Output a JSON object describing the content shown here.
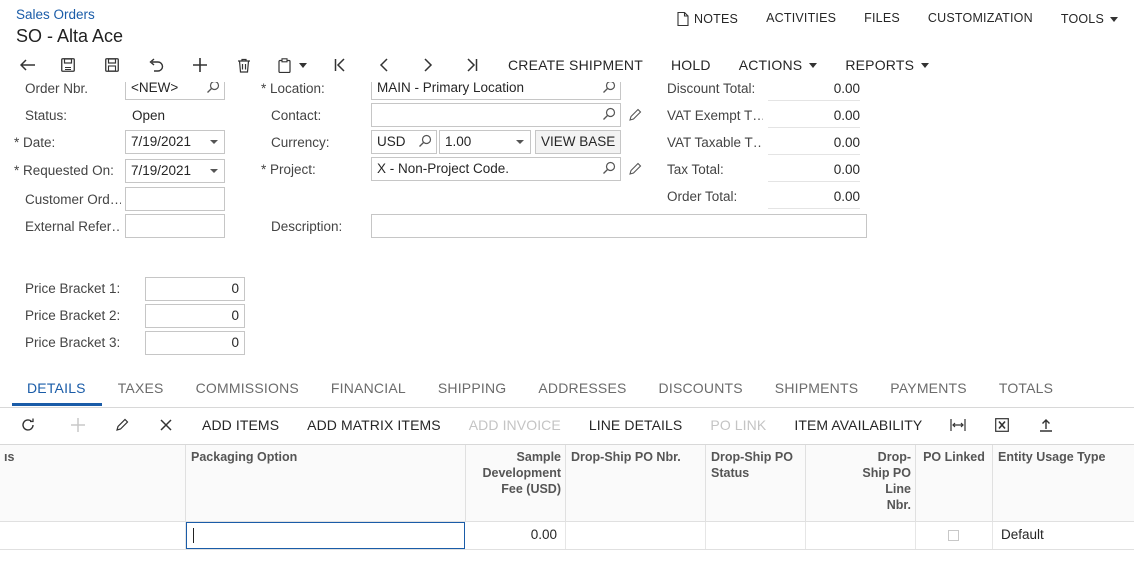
{
  "header": {
    "breadcrumb": "Sales Orders",
    "title": "SO - Alta Ace",
    "links": {
      "notes": "NOTES",
      "activities": "ACTIVITIES",
      "files": "FILES",
      "customization": "CUSTOMIZATION",
      "tools": "TOOLS"
    }
  },
  "toolbar": {
    "create_shipment": "CREATE SHIPMENT",
    "hold": "HOLD",
    "actions": "ACTIONS",
    "reports": "REPORTS"
  },
  "form": {
    "order_nbr": {
      "label": "Order Nbr.",
      "value": "<NEW>"
    },
    "status": {
      "label": "Status:",
      "value": "Open"
    },
    "date": {
      "label": "Date:",
      "value": "7/19/2021"
    },
    "requested_on": {
      "label": "Requested On:",
      "value": "7/19/2021"
    },
    "customer_order": {
      "label": "Customer Ord…",
      "value": ""
    },
    "external_ref": {
      "label": "External Refer…",
      "value": ""
    },
    "location": {
      "label": "Location:",
      "value": "MAIN - Primary Location"
    },
    "contact": {
      "label": "Contact:",
      "value": ""
    },
    "currency": {
      "label": "Currency:",
      "value": "USD",
      "rate": "1.00",
      "view_base": "VIEW BASE"
    },
    "project": {
      "label": "Project:",
      "value": "X - Non-Project Code."
    },
    "description": {
      "label": "Description:",
      "value": ""
    },
    "discount_total": {
      "label": "Discount Total:",
      "value": "0.00"
    },
    "vat_exempt": {
      "label": "VAT Exempt T…",
      "value": "0.00"
    },
    "vat_taxable": {
      "label": "VAT Taxable T…",
      "value": "0.00"
    },
    "tax_total": {
      "label": "Tax Total:",
      "value": "0.00"
    },
    "order_total": {
      "label": "Order Total:",
      "value": "0.00"
    },
    "price_bracket_1": {
      "label": "Price Bracket 1:",
      "value": "0"
    },
    "price_bracket_2": {
      "label": "Price Bracket 2:",
      "value": "0"
    },
    "price_bracket_3": {
      "label": "Price Bracket 3:",
      "value": "0"
    }
  },
  "tabs": [
    "DETAILS",
    "TAXES",
    "COMMISSIONS",
    "FINANCIAL",
    "SHIPPING",
    "ADDRESSES",
    "DISCOUNTS",
    "SHIPMENTS",
    "PAYMENTS",
    "TOTALS"
  ],
  "grid_toolbar": {
    "add_items": "ADD ITEMS",
    "add_matrix_items": "ADD MATRIX ITEMS",
    "add_invoice": "ADD INVOICE",
    "line_details": "LINE DETAILS",
    "po_link": "PO LINK",
    "item_availability": "ITEM AVAILABILITY"
  },
  "grid": {
    "headers": {
      "cut": "ıs",
      "packaging_option": "Packaging Option",
      "sample_fee": "Sample Development Fee (USD)",
      "dropship_po_nbr": "Drop-Ship PO Nbr.",
      "dropship_po_status": "Drop-Ship PO Status",
      "dropship_po_line": "Drop-Ship PO Line Nbr.",
      "po_linked": "PO Linked",
      "entity_usage_type": "Entity Usage Type"
    },
    "row": {
      "packaging_option": "",
      "sample_fee": "0.00",
      "dropship_po_nbr": "",
      "dropship_po_status": "",
      "dropship_po_line": "",
      "po_linked": false,
      "entity_usage_type": "Default"
    }
  }
}
